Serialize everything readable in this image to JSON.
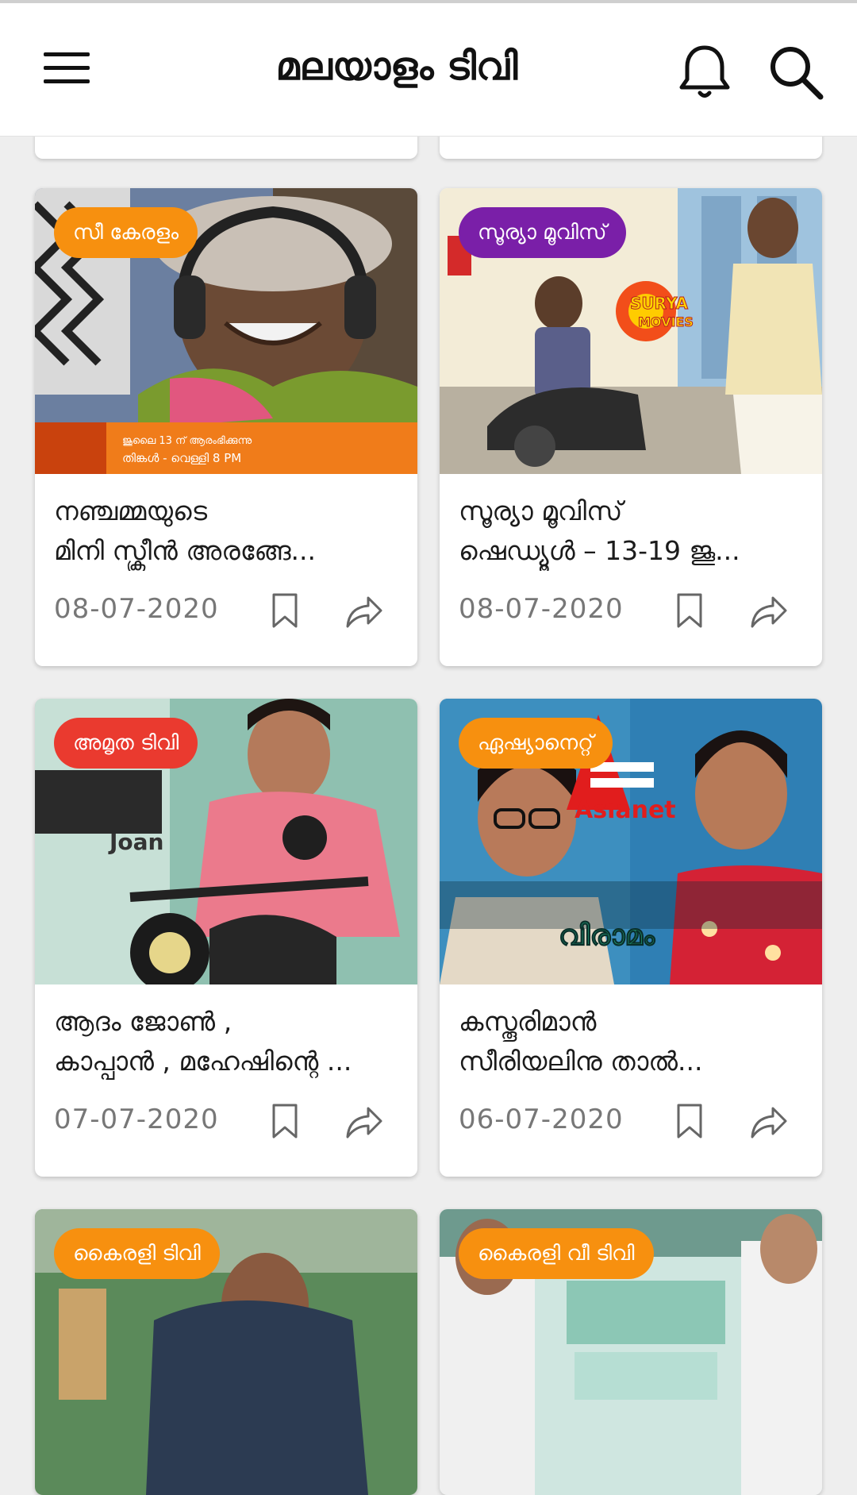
{
  "appbar": {
    "title": "മലയാളം ടിവി",
    "icons": [
      "menu-icon",
      "bell-icon",
      "search-icon"
    ]
  },
  "colors": {
    "orange": "#f7900f",
    "purple": "#7a1fa8",
    "red": "#ea3a2f"
  },
  "cards": [
    {
      "badge": "സീ കേരളം",
      "badge_color": "#f7900f",
      "title_line1": "നഞ്ചമ്മയുടെ",
      "title_line2": "മിനി സ്ക്രീൻ അരങ്ങേ...",
      "date": "08-07-2020",
      "image_text1": "ജൂലൈ 13 ന് ആരംഭിക്കുന്നു",
      "image_text2": "തിങ്കൾ - വെള്ളി 8 PM"
    },
    {
      "badge": "സൂര്യാ മൂവിസ്",
      "badge_color": "#7a1fa8",
      "title_line1": "സൂര്യാ മൂവിസ്",
      "title_line2": "ഷെഡ്യൂൾ – 13-19 ജൂ...",
      "date": "08-07-2020",
      "image_text1": "SURYA",
      "image_text2": "MOVIES"
    },
    {
      "badge": "അമൃത ടിവി",
      "badge_color": "#ea3a2f",
      "title_line1": "ആദം ജോൺ ,",
      "title_line2": "കാപ്പാൻ , മഹേഷിന്റെ ...",
      "date": "07-07-2020",
      "image_text1": "Joan"
    },
    {
      "badge": "ഏഷ്യാനെറ്റ്",
      "badge_color": "#f7900f",
      "title_line1": "കസ്തൂരിമാൻ",
      "title_line2": "സീരിയലിനു താൽ...",
      "date": "06-07-2020",
      "image_text1": "Asianet",
      "image_text2": "വിരാമം"
    },
    {
      "badge": "കൈരളി ടിവി",
      "badge_color": "#f7900f"
    },
    {
      "badge": "കൈരളി വീ ടിവി",
      "badge_color": "#f7900f"
    }
  ]
}
